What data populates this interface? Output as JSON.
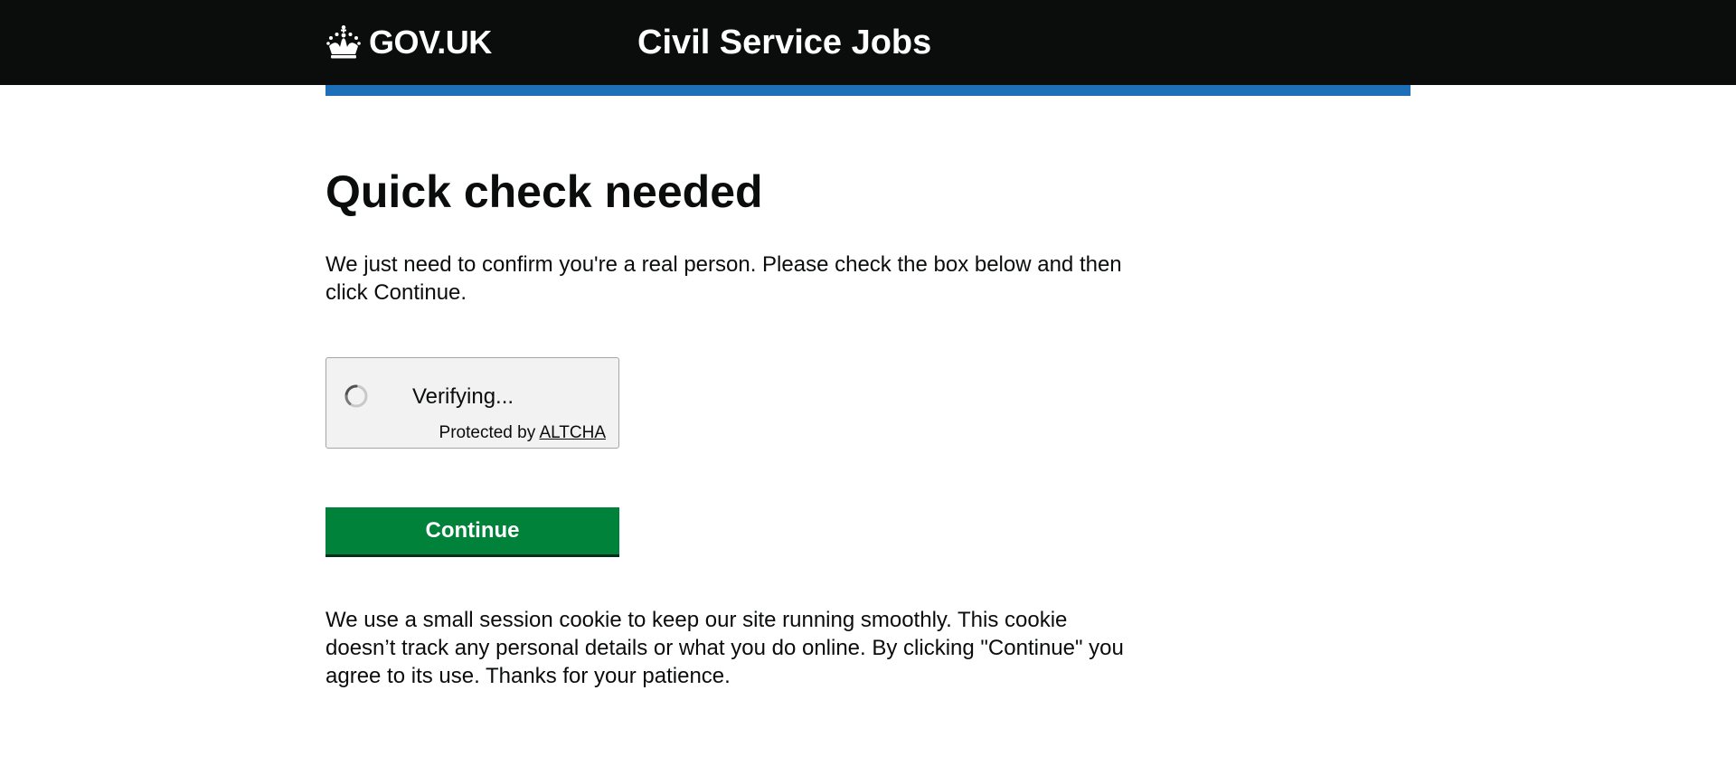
{
  "header": {
    "logo_text": "GOV.UK",
    "logo_icon": "crown-icon",
    "service_name": "Civil Service Jobs",
    "background_color": "#0b0c0c",
    "accent_bar_color": "#1d70b8"
  },
  "main": {
    "title": "Quick check needed",
    "intro": "We just need to confirm you're a real person. Please check the box below and then click Continue.",
    "captcha": {
      "spinner_icon": "spinner-icon",
      "status_text": "Verifying...",
      "protected_by": "Protected by",
      "provider_link": "ALTCHA",
      "background_color": "#f2f2f2"
    },
    "continue_label": "Continue",
    "continue_color": "#00823b",
    "cookie_notice": "We use a small session cookie to keep our site running smoothly. This cookie doesn’t track any personal details or what you do online. By clicking \"Continue\" you agree to its use. Thanks for your patience."
  }
}
